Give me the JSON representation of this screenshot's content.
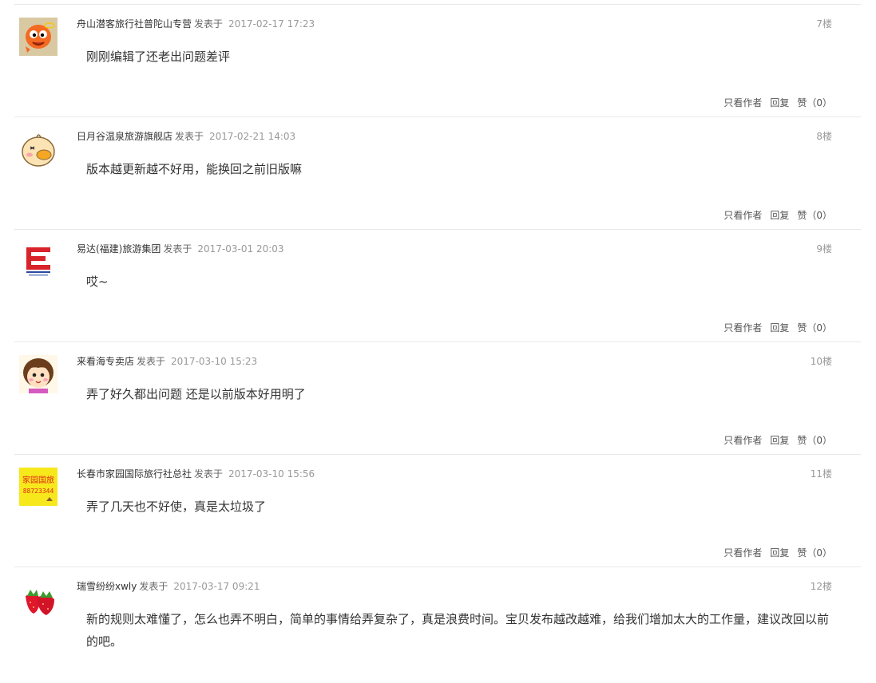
{
  "posts": [
    {
      "author": "舟山潜客旅行社普陀山专营",
      "posted_label": "发表于",
      "time": "2017-02-17 17:23",
      "floor": "7楼",
      "content": "刚刚编辑了还老出问题差评",
      "avatar_icon": "orange-cartoon-avatar",
      "actions": {
        "author_only": "只看作者",
        "reply": "回复",
        "like": "赞（0）"
      }
    },
    {
      "author": "日月谷温泉旅游旗舰店",
      "posted_label": "发表于",
      "time": "2017-02-21 14:03",
      "floor": "8楼",
      "content": "版本越更新越不好用，能换回之前旧版嘛",
      "avatar_icon": "duck-cartoon-avatar",
      "actions": {
        "author_only": "只看作者",
        "reply": "回复",
        "like": "赞（0）"
      }
    },
    {
      "author": "易达(福建)旅游集团",
      "posted_label": "发表于",
      "time": "2017-03-01 20:03",
      "floor": "9楼",
      "content": "哎~",
      "avatar_icon": "red-logo-avatar",
      "actions": {
        "author_only": "只看作者",
        "reply": "回复",
        "like": "赞（0）"
      }
    },
    {
      "author": "来看海专卖店",
      "posted_label": "发表于",
      "time": "2017-03-10 15:23",
      "floor": "10楼",
      "content": "弄了好久都出问题 还是以前版本好用明了",
      "avatar_icon": "girl-cartoon-avatar",
      "actions": {
        "author_only": "只看作者",
        "reply": "回复",
        "like": "赞（0）"
      }
    },
    {
      "author": "长春市家园国际旅行社总社",
      "posted_label": "发表于",
      "time": "2017-03-10 15:56",
      "floor": "11楼",
      "content": "弄了几天也不好使，真是太垃圾了",
      "avatar_icon": "yellow-sign-avatar",
      "avatar_text": [
        "家园国旅",
        "88723344"
      ],
      "actions": {
        "author_only": "只看作者",
        "reply": "回复",
        "like": "赞（0）"
      }
    },
    {
      "author": "瑞雪纷纷xwly",
      "posted_label": "发表于",
      "time": "2017-03-17 09:21",
      "floor": "12楼",
      "content": "新的规则太难懂了，怎么也弄不明白，简单的事情给弄复杂了，真是浪费时间。宝贝发布越改越难，给我们增加太大的工作量，建议改回以前的吧。",
      "avatar_icon": "strawberry-avatar"
    }
  ],
  "colors": {
    "divider": "#e8e8e8",
    "text": "#333333",
    "meta_time": "#999999"
  }
}
